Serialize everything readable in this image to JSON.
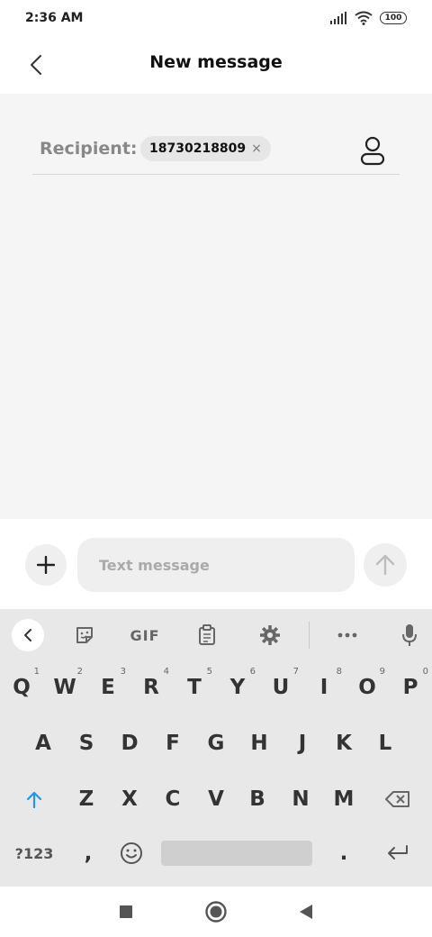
{
  "status_bar": {
    "time": "2:36 AM",
    "battery": "100"
  },
  "header": {
    "title": "New message"
  },
  "recipient": {
    "label": "Recipient:",
    "chip_value": "18730218809",
    "chip_close": "×"
  },
  "compose": {
    "placeholder": "Text message"
  },
  "keyboard": {
    "toolbar": {
      "gif": "GIF"
    },
    "row1": [
      {
        "label": "Q",
        "hint": "1"
      },
      {
        "label": "W",
        "hint": "2"
      },
      {
        "label": "E",
        "hint": "3"
      },
      {
        "label": "R",
        "hint": "4"
      },
      {
        "label": "T",
        "hint": "5"
      },
      {
        "label": "Y",
        "hint": "6"
      },
      {
        "label": "U",
        "hint": "7"
      },
      {
        "label": "I",
        "hint": "8"
      },
      {
        "label": "O",
        "hint": "9"
      },
      {
        "label": "P",
        "hint": "0"
      }
    ],
    "row2": [
      "A",
      "S",
      "D",
      "F",
      "G",
      "H",
      "J",
      "K",
      "L"
    ],
    "row3": [
      "Z",
      "X",
      "C",
      "V",
      "B",
      "N",
      "M"
    ],
    "row4": {
      "symbols": "?123",
      "comma": ",",
      "period": "."
    }
  },
  "colors": {
    "accent": "#2196F3",
    "content_bg": "#f5f5f5",
    "keyboard_bg": "#e8e8e8"
  }
}
